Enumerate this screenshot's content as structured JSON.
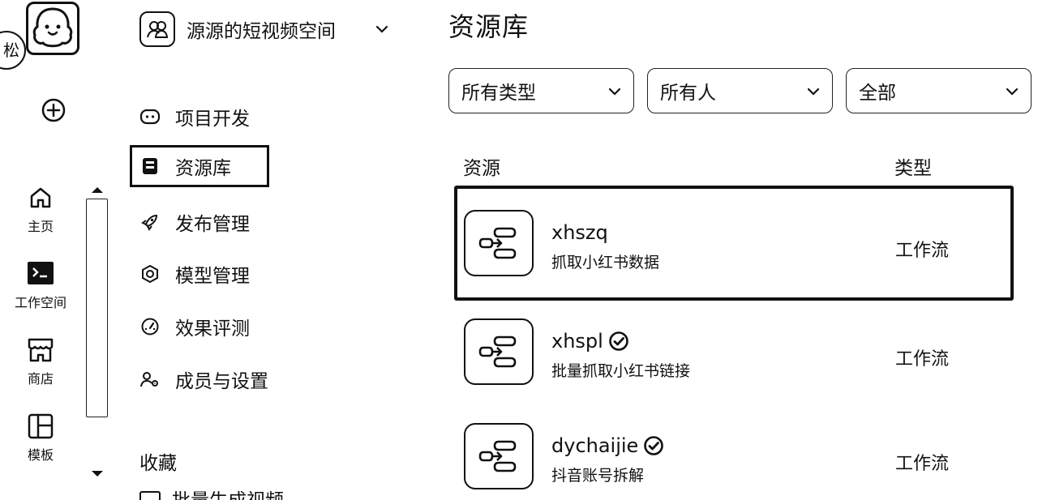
{
  "rail": {
    "avatar_text": "松",
    "items": [
      {
        "label": "主页",
        "icon": "home-icon"
      },
      {
        "label": "工作空间",
        "icon": "workspace-icon"
      },
      {
        "label": "商店",
        "icon": "store-icon"
      },
      {
        "label": "模板",
        "icon": "template-icon"
      }
    ]
  },
  "workspace": {
    "name": "源源的短视频空间"
  },
  "nav": {
    "items": [
      {
        "label": "项目开发",
        "icon": "bot-icon"
      },
      {
        "label": "资源库",
        "icon": "library-icon",
        "active": true
      },
      {
        "label": "发布管理",
        "icon": "rocket-icon"
      },
      {
        "label": "模型管理",
        "icon": "model-icon"
      },
      {
        "label": "效果评测",
        "icon": "gauge-icon"
      },
      {
        "label": "成员与设置",
        "icon": "members-icon"
      }
    ],
    "favorites_title": "收藏",
    "favorites_partial": "批量生成视频"
  },
  "main": {
    "title": "资源库",
    "filters": {
      "type": "所有类型",
      "owner": "所有人",
      "status": "全部"
    },
    "columns": {
      "resource": "资源",
      "type": "类型"
    },
    "resources": [
      {
        "name": "xhszq",
        "description": "抓取小红书数据",
        "type": "工作流",
        "verified": false,
        "selected": true
      },
      {
        "name": "xhspl",
        "description": "批量抓取小红书链接",
        "type": "工作流",
        "verified": true,
        "selected": false
      },
      {
        "name": "dychaijie",
        "description": "抖音账号拆解",
        "type": "工作流",
        "verified": true,
        "selected": false
      }
    ]
  },
  "colors": {
    "foreground": "#111111",
    "background": "#ffffff"
  }
}
